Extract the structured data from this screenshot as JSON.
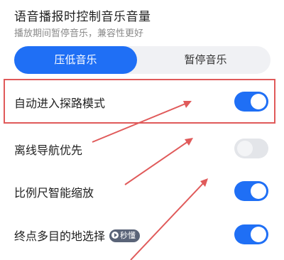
{
  "header": {
    "title": "语音播报时控制音乐音量",
    "subtitle": "播放期间暂停音乐，兼容性更好"
  },
  "segment": {
    "left_label": "压低音乐",
    "right_label": "暂停音乐",
    "selected": "压低音乐"
  },
  "settings": [
    {
      "label": "自动进入探路模式",
      "enabled": true
    },
    {
      "label": "离线导航优先",
      "enabled": false
    },
    {
      "label": "比例尺智能缩放",
      "enabled": true
    },
    {
      "label": "终点多目的地选择",
      "enabled": true,
      "badge": "秒懂"
    }
  ],
  "colors": {
    "accent": "#1f6ff5",
    "highlight": "#e05a5a"
  }
}
